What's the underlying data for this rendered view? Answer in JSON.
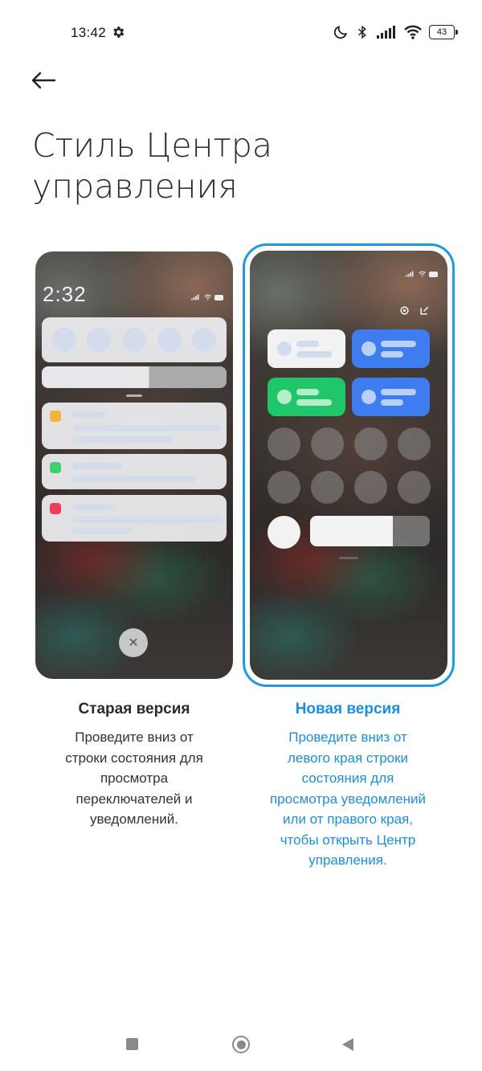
{
  "status_bar": {
    "time": "13:42",
    "battery": "43",
    "icons": [
      "gear-icon",
      "moon-icon",
      "bluetooth-icon",
      "signal-icon",
      "wifi-icon",
      "battery-icon"
    ]
  },
  "header": {
    "title_line1": "Стиль Центра",
    "title_line2": "управления",
    "back_icon": "arrow-left-icon"
  },
  "preview_old": {
    "time": "2:32",
    "close_glyph": "✕"
  },
  "option_old": {
    "title": "Старая версия",
    "description": "Проведите вниз от строки состояния для просмотра переключателей и уведомлений."
  },
  "option_new": {
    "title": "Новая версия",
    "description": "Проведите вниз от левого края строки состояния для просмотра уведомлений или от правого края, чтобы открыть Центр управления.",
    "selected": true
  },
  "colors": {
    "accent": "#1e9ae5",
    "tile_white": "#f2f2f2",
    "tile_blue": "#3f7cf0",
    "tile_green": "#1fc76a",
    "caption_blue": "#1b8fdd"
  },
  "nav_bar": {
    "icons": [
      "recents-icon",
      "home-icon",
      "back-icon"
    ]
  }
}
